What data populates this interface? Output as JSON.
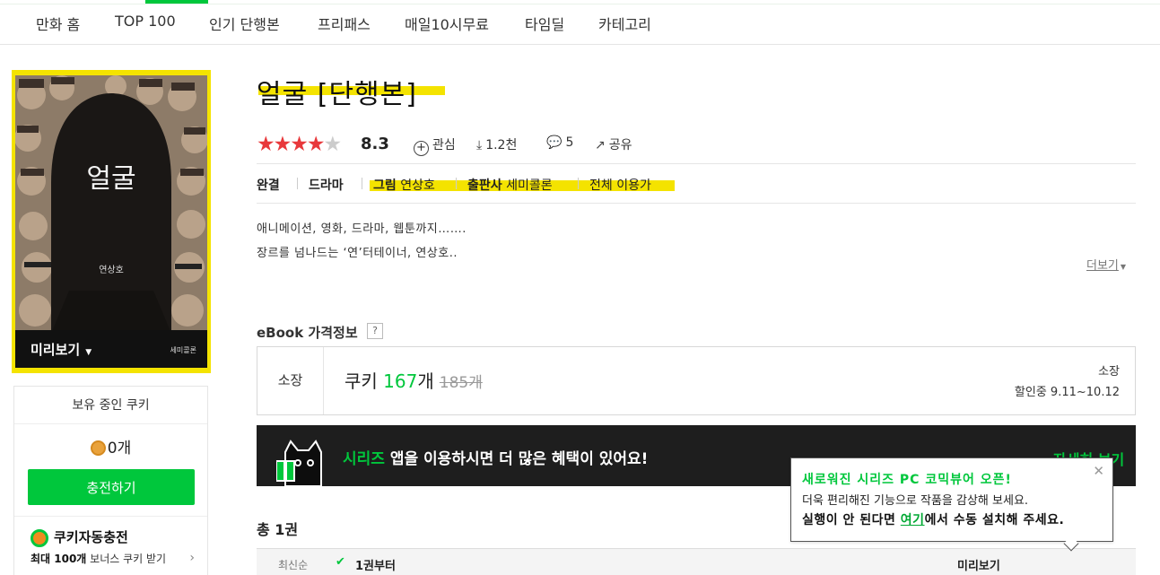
{
  "nav": {
    "items": [
      "만화 홈",
      "TOP 100",
      "인기 단행본",
      "프리패스",
      "매일10시무료",
      "타임딜",
      "카테고리"
    ]
  },
  "cover": {
    "title_text": "얼굴",
    "author_text": "연상호",
    "preview_label": "미리보기",
    "publisher_mark": "세미콜론"
  },
  "cookie": {
    "title": "보유 중인 쿠키",
    "count": "0개",
    "charge_label": "충전하기",
    "auto_title": "쿠키자동충전",
    "auto_sub_bold": "최대 100개",
    "auto_sub_rest": " 보너스 쿠키 받기"
  },
  "book": {
    "title": "얼굴 [단행본]",
    "score": "8.3",
    "rating_stars": 4,
    "interest_label": "관심",
    "downloads": "1.2천",
    "comments": "5",
    "share_label": "공유"
  },
  "info": {
    "status": "완결",
    "genre": "드라마",
    "art_label": "그림",
    "art_value": "연상호",
    "publisher_label": "출판사",
    "publisher_value": "세미콜론",
    "age": "전체 이용가"
  },
  "synopsis": {
    "line1": "애니메이션, 영화, 드라마, 웹툰까지…….",
    "line2": "장르를 넘나드는 ‘연’터테이너, 연상호..",
    "more_label": "더보기"
  },
  "ebook": {
    "label": "eBook 가격정보",
    "help": "?",
    "own_label": "소장",
    "cookie_label": "쿠키",
    "price": "167",
    "unit": "개",
    "original_price": "185개",
    "right_label": "소장",
    "discount": "할인중 9.11~10.12"
  },
  "banner": {
    "series": "시리즈",
    "text": " 앱을 이용하시면 더 많은 혜택이 있어요!",
    "more": "자세히 보기"
  },
  "list": {
    "total": "총 1권",
    "sort": "최신순",
    "from_label": "1권부터",
    "preview_label": "미리보기"
  },
  "popup": {
    "line1": "새로워진 시리즈 PC 코믹뷰어 오픈!",
    "line2": "더욱 편리해진 기능으로 작품을 감상해 보세요.",
    "line3_pre": "실행이 안 된다면 ",
    "line3_link": "여기",
    "line3_post": "에서 수동 설치해 주세요."
  },
  "colors": {
    "accent_green": "#00c73c",
    "highlight_yellow": "#f4e300",
    "star_red": "#e8383b"
  }
}
